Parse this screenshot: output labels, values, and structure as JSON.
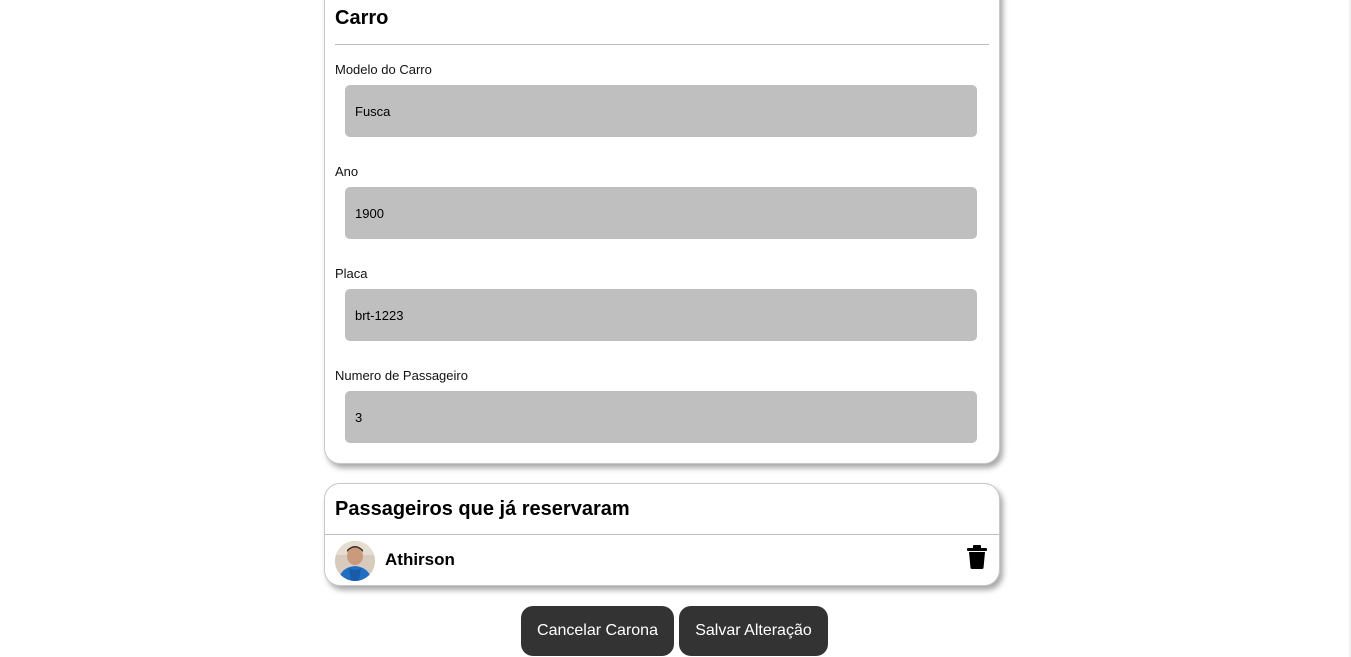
{
  "car_section": {
    "title": "Carro",
    "fields": [
      {
        "label": "Modelo do Carro",
        "value": "Fusca"
      },
      {
        "label": "Ano",
        "value": "1900"
      },
      {
        "label": "Placa",
        "value": "brt-1223"
      },
      {
        "label": "Numero de Passageiro",
        "value": "3"
      }
    ]
  },
  "passengers_section": {
    "title": "Passageiros que já reservaram",
    "passengers": [
      {
        "name": "Athirson",
        "avatar_icon": "user-photo",
        "action_icon": "trash-icon"
      }
    ]
  },
  "actions": {
    "cancel_label": "Cancelar Carona",
    "save_label": "Salvar Alteração"
  },
  "colors": {
    "button_bg": "#333333",
    "input_bg": "#bfbfbf"
  }
}
